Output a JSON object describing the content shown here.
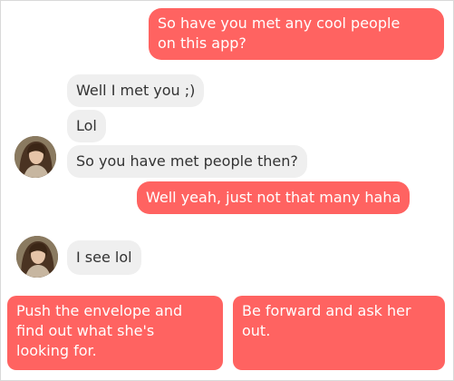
{
  "messages": [
    {
      "text": "So have you met any cool people on this app?",
      "line1": "So have you met any cool people",
      "line2": "on this app?",
      "from": "me"
    },
    {
      "text": "Well I met you ;)",
      "from": "her"
    },
    {
      "text": "Lol",
      "from": "her"
    },
    {
      "text": "So you have met people then?",
      "from": "her"
    },
    {
      "text": "Well yeah, just not that many haha",
      "from": "me"
    },
    {
      "text": "I see lol",
      "from": "her"
    }
  ],
  "reply_options": [
    {
      "line1": "Push the envelope and",
      "line2": "find out what she's",
      "line3": "looking for."
    },
    {
      "line1": "Be forward and ask her",
      "line2": "out."
    }
  ],
  "colors": {
    "accent": "#ff6361",
    "received_bubble": "#efefef",
    "text": "#333333"
  },
  "icons": {
    "avatar": "contact-avatar-photo"
  }
}
